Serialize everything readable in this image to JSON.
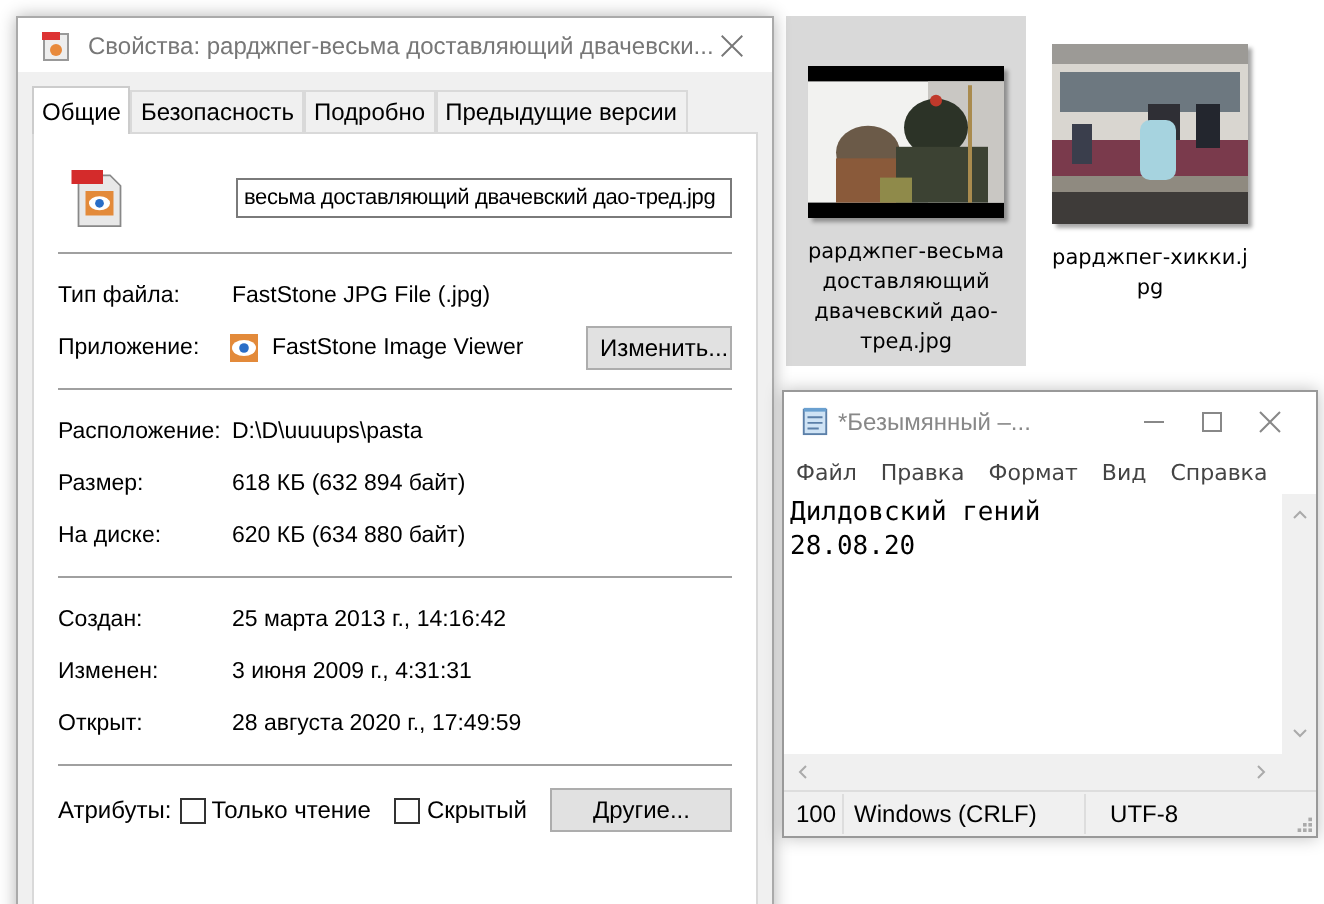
{
  "explorer": {
    "files": [
      {
        "name": "рарджпег-весьма доставляющий двачевский дао-тред.jpg",
        "selected": true,
        "kind": "picture"
      },
      {
        "name": "рарджпег-хикки.jpg",
        "selected": false,
        "kind": "picture"
      }
    ]
  },
  "properties": {
    "title": "Свойства: рарджпег-весьма доставляющий двачевски...",
    "tabs": [
      {
        "label": "Общие",
        "selected": true
      },
      {
        "label": "Безопасность",
        "selected": false
      },
      {
        "label": "Подробно",
        "selected": false
      },
      {
        "label": "Предыдущие версии",
        "selected": false
      }
    ],
    "filename": "весьма доставляющий двачевский дао-тред.jpg",
    "groups": [
      [
        {
          "label": "Тип файла:",
          "value": "FastStone JPG File (.jpg)"
        },
        {
          "label": "Приложение:",
          "value": "FastStone Image Viewer",
          "kind": "app",
          "button": "Изменить..."
        }
      ],
      [
        {
          "label": "Расположение:",
          "value": "D:\\D\\uuuups\\pasta"
        },
        {
          "label": "Размер:",
          "value": "618 КБ (632 894 байт)"
        },
        {
          "label": "На диске:",
          "value": "620 КБ (634 880 байт)"
        }
      ],
      [
        {
          "label": "Создан:",
          "value": "25 марта 2013 г., 14:16:42"
        },
        {
          "label": "Изменен:",
          "value": "3 июня 2009 г., 4:31:31"
        },
        {
          "label": "Открыт:",
          "value": "28 августа 2020 г., 17:49:59"
        }
      ]
    ],
    "attributes_label": "Атрибуты:",
    "attributes": [
      {
        "label": "Только чтение",
        "checked": false
      },
      {
        "label": "Скрытый",
        "checked": false
      }
    ],
    "other_button": "Другие..."
  },
  "notepad": {
    "title": "*Безымянный –...",
    "menu": [
      "Файл",
      "Правка",
      "Формат",
      "Вид",
      "Справка"
    ],
    "lines": [
      "Дилдовский гений",
      "28.08.20"
    ],
    "status": [
      "100",
      "Windows (CRLF)",
      "UTF-8"
    ]
  }
}
